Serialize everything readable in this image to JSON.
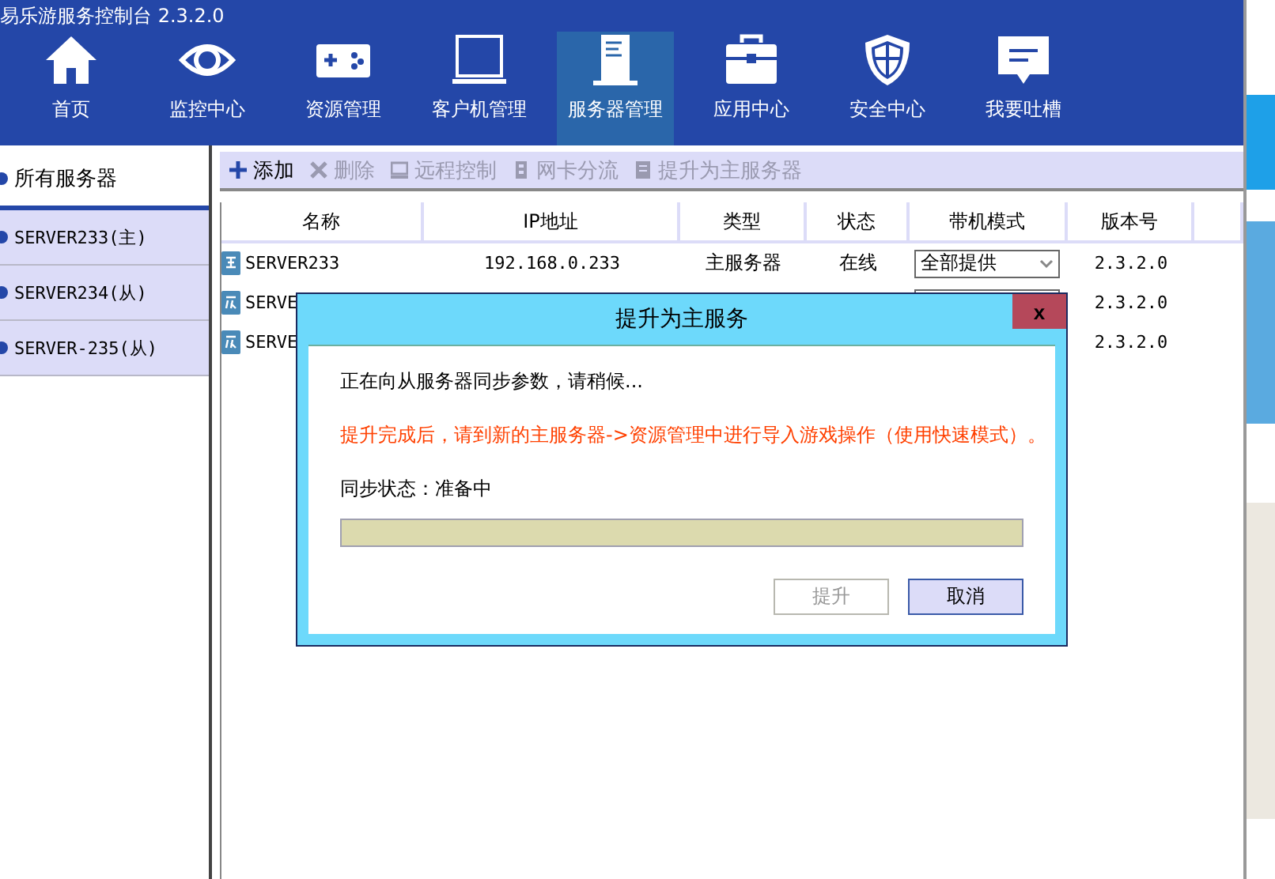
{
  "window": {
    "title": "易乐游服务控制台 2.3.2.0"
  },
  "nav": [
    {
      "label": "首页",
      "selected": false
    },
    {
      "label": "监控中心",
      "selected": false
    },
    {
      "label": "资源管理",
      "selected": false
    },
    {
      "label": "客户机管理",
      "selected": false
    },
    {
      "label": "服务器管理",
      "selected": true
    },
    {
      "label": "应用中心",
      "selected": false
    },
    {
      "label": "安全中心",
      "selected": false
    },
    {
      "label": "我要吐槽",
      "selected": false
    }
  ],
  "sidebar": {
    "items": [
      {
        "label": "所有服务器",
        "selected": true
      },
      {
        "label": "SERVER233(主)",
        "selected": false
      },
      {
        "label": "SERVER234(从)",
        "selected": false
      },
      {
        "label": "SERVER-235(从)",
        "selected": false
      }
    ]
  },
  "toolbar": [
    {
      "label": "添加",
      "disabled": false
    },
    {
      "label": "删除",
      "disabled": true
    },
    {
      "label": "远程控制",
      "disabled": true
    },
    {
      "label": "网卡分流",
      "disabled": true
    },
    {
      "label": "提升为主服务器",
      "disabled": true
    }
  ],
  "table": {
    "columns": [
      "名称",
      "IP地址",
      "类型",
      "状态",
      "带机模式",
      "版本号"
    ],
    "rows": [
      {
        "kind": "master",
        "name": "SERVER233",
        "ip": "192.168.0.233",
        "type": "主服务器",
        "status": "在线",
        "mode": "全部提供",
        "version": "2.3.2.0"
      },
      {
        "kind": "slave",
        "name": "SERVE",
        "version": "2.3.2.0"
      },
      {
        "kind": "slave",
        "name": "SERVE",
        "version": "2.3.2.0"
      }
    ]
  },
  "dialog": {
    "title": "提升为主服务",
    "close": "x",
    "message": "正在向从服务器同步参数，请稍候...",
    "warning": "提升完成后，请到新的主服务器->资源管理中进行导入游戏操作（使用快速模式）。",
    "status": "同步状态：准备中",
    "level": 0,
    "buttons": [
      {
        "label": "提升",
        "disabled": true
      },
      {
        "label": "取消",
        "disabled": false
      }
    ]
  }
}
